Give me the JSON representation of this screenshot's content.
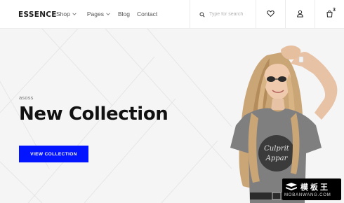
{
  "header": {
    "logo": "ESSENCE",
    "nav": [
      {
        "label": "Shop",
        "has_dropdown": true
      },
      {
        "label": "Pages",
        "has_dropdown": true
      },
      {
        "label": "Blog",
        "has_dropdown": false
      },
      {
        "label": "Contact",
        "has_dropdown": false
      }
    ],
    "search": {
      "placeholder": "Type for search",
      "icon": "search-icon"
    },
    "icons": [
      "heart-icon",
      "user-icon",
      "cart-icon"
    ],
    "cart_count": "3"
  },
  "hero": {
    "brand_label": "asoss",
    "title": "New Collection",
    "cta_label": "VIEW COLLECTION",
    "cta_color": "#0315ff",
    "background": "#f5f5f5"
  },
  "watermark": {
    "text_cn": "模板王",
    "text_en": "MOBANWANG.COM"
  }
}
